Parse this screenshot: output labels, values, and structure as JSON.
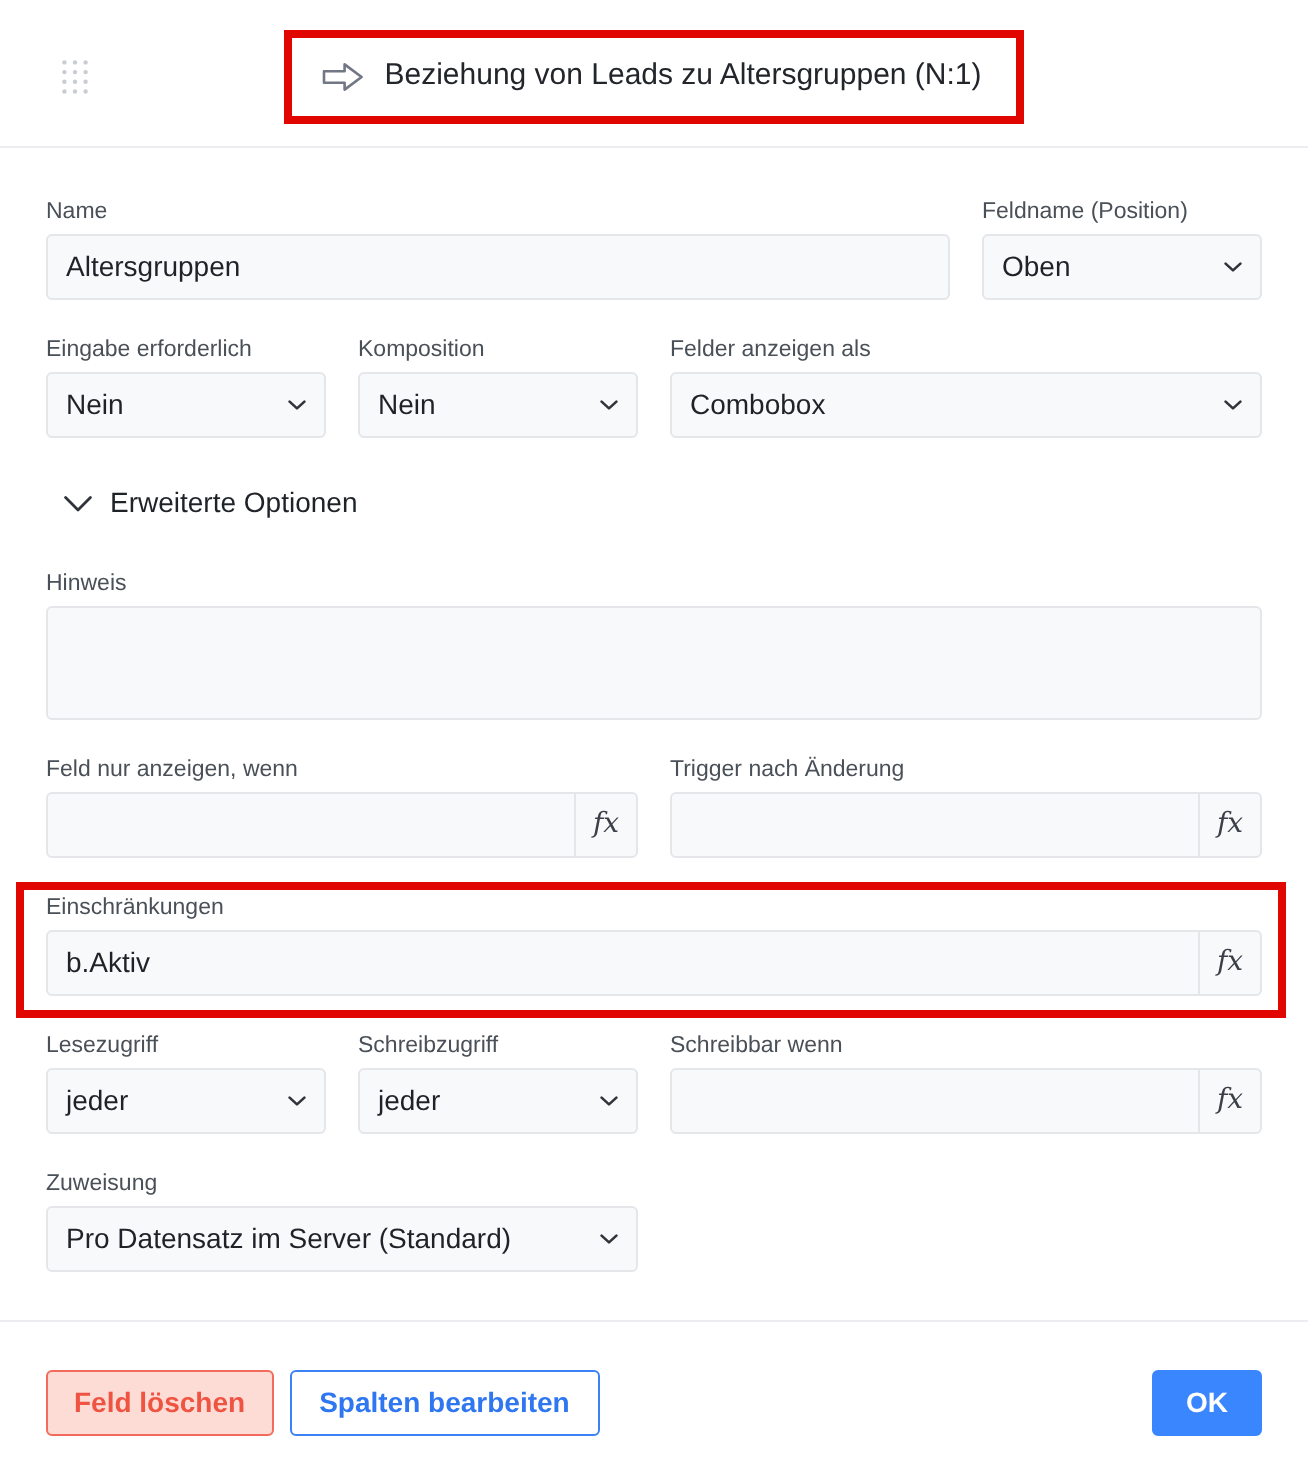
{
  "header": {
    "title": "Beziehung von Leads zu Altersgruppen (N:1)",
    "highlighted": true
  },
  "form": [
    {
      "kind": "fields",
      "highlighted": false,
      "fields": [
        {
          "kind": "text",
          "label": "Name",
          "value": "Altersgruppen"
        },
        {
          "kind": "select",
          "label": "Feldname (Position)",
          "value": "Oben"
        }
      ]
    },
    {
      "kind": "fields",
      "highlighted": false,
      "fields": [
        {
          "kind": "select",
          "label": "Eingabe erforderlich",
          "value": "Nein"
        },
        {
          "kind": "select",
          "label": "Komposition",
          "value": "Nein"
        },
        {
          "kind": "select",
          "label": "Felder anzeigen als",
          "value": "Combobox"
        }
      ]
    },
    {
      "kind": "expander",
      "highlighted": false,
      "label": "Erweiterte Optionen",
      "expanded": true
    },
    {
      "kind": "fields",
      "highlighted": false,
      "fields": [
        {
          "kind": "textarea",
          "label": "Hinweis"
        }
      ]
    },
    {
      "kind": "fields",
      "highlighted": false,
      "fields": [
        {
          "kind": "formula",
          "label": "Feld nur anzeigen, wenn",
          "button": "fx"
        },
        {
          "kind": "formula",
          "label": "Trigger nach Änderung",
          "button": "fx"
        }
      ]
    },
    {
      "kind": "fields",
      "highlighted": true,
      "fields": [
        {
          "kind": "formula",
          "label": "Einschränkungen",
          "value": "b.Aktiv",
          "button": "fx"
        }
      ]
    },
    {
      "kind": "fields",
      "highlighted": false,
      "fields": [
        {
          "kind": "select",
          "label": "Lesezugriff",
          "value": "jeder"
        },
        {
          "kind": "select",
          "label": "Schreibzugriff",
          "value": "jeder"
        },
        {
          "kind": "formula",
          "label": "Schreibbar wenn",
          "button": "fx"
        }
      ]
    },
    {
      "kind": "fields",
      "highlighted": false,
      "fields": [
        {
          "kind": "select",
          "label": "Zuweisung",
          "value": "Pro Datensatz im Server (Standard)"
        }
      ]
    }
  ],
  "footer": {
    "buttons": [
      {
        "kind": "danger",
        "label": "Feld löschen"
      },
      {
        "kind": "secondary",
        "label": "Spalten bearbeiten"
      },
      {
        "kind": "primary",
        "label": "OK"
      }
    ]
  }
}
